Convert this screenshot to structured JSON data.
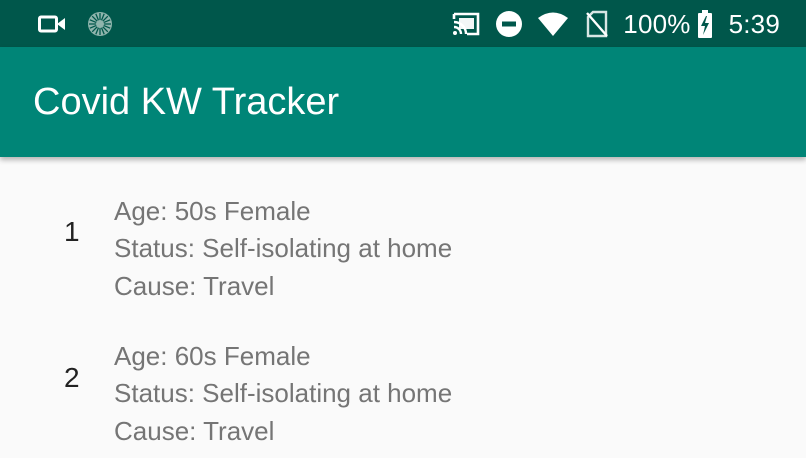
{
  "status_bar": {
    "left_icons": [
      "video-camera-icon",
      "loading-spinner-icon"
    ],
    "right_icons": [
      "cast-icon",
      "do-not-disturb-icon",
      "wifi-icon",
      "no-sim-icon"
    ],
    "battery": "100%",
    "time": "5:39"
  },
  "app_bar": {
    "title": "Covid KW Tracker"
  },
  "cases": [
    {
      "number": "1",
      "age": "Age: 50s Female",
      "status": "Status: Self-isolating at home",
      "cause": "Cause: Travel"
    },
    {
      "number": "2",
      "age": "Age: 60s Female",
      "status": "Status: Self-isolating at home",
      "cause": "Cause: Travel"
    }
  ],
  "colors": {
    "status_bar": "#00574b",
    "app_bar": "#008577",
    "background": "#fafafa",
    "secondary_text": "#757575"
  }
}
